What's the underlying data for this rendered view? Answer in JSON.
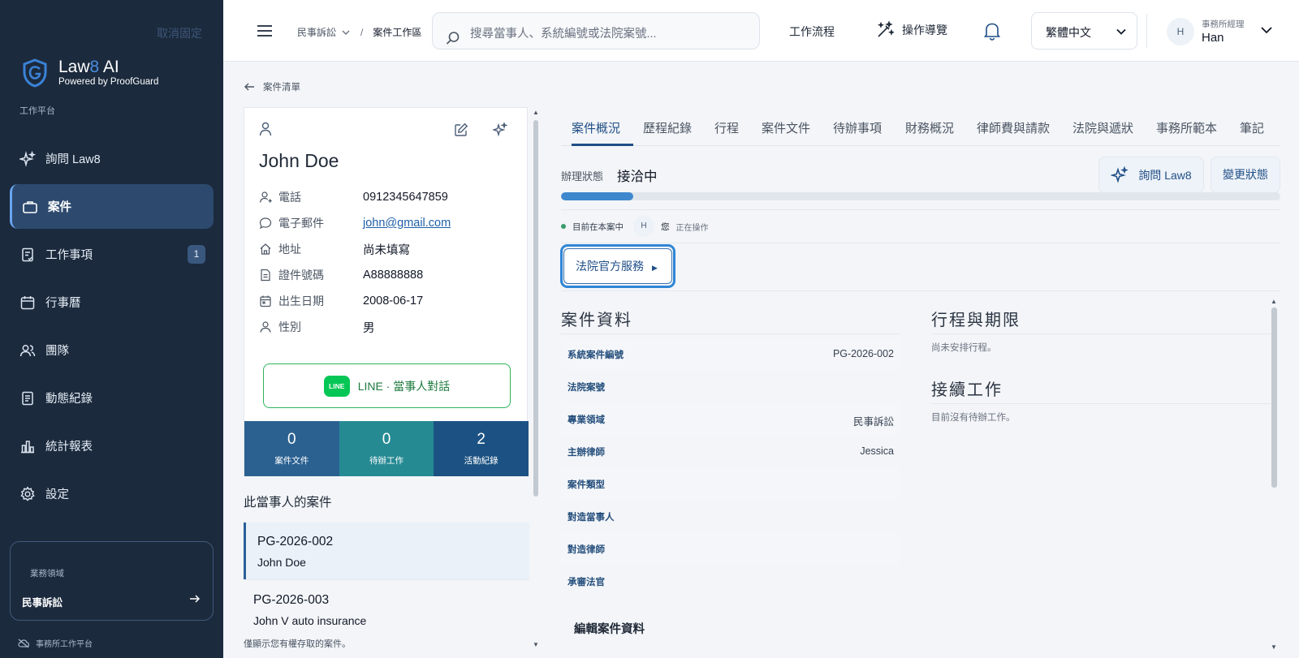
{
  "sidebar": {
    "unpin_label": "取消固定",
    "brand_prefix": "Law",
    "brand_eight": "8",
    "brand_suffix": " AI",
    "brand_sub": "Powered by ProofGuard",
    "section_label": "工作平台",
    "items": [
      {
        "label": "詢問 Law8",
        "icon": "sparkle-icon"
      },
      {
        "label": "案件",
        "icon": "briefcase-icon",
        "active": true
      },
      {
        "label": "工作事項",
        "icon": "task-icon",
        "badge": "1"
      },
      {
        "label": "行事曆",
        "icon": "calendar-icon"
      },
      {
        "label": "團隊",
        "icon": "team-icon"
      },
      {
        "label": "動態紀錄",
        "icon": "log-icon"
      },
      {
        "label": "統計報表",
        "icon": "chart-icon"
      },
      {
        "label": "設定",
        "icon": "gear-icon"
      }
    ],
    "domain_label": "業務領域",
    "domain_value": "民事訴訟",
    "footer_status": "事務所工作平台"
  },
  "topbar": {
    "breadcrumb_parent": "民事訴訟",
    "breadcrumb_current": "案件工作區",
    "search_placeholder": "搜尋當事人、系統編號或法院案號...",
    "workflow_label": "工作流程",
    "guide_label": "操作導覽",
    "language": "繁體中文",
    "user_role": "事務所經理",
    "user_name": "Han",
    "user_initial": "H"
  },
  "back_label": "案件清單",
  "client": {
    "name": "John Doe",
    "fields": [
      {
        "label": "電話",
        "value": "0912345647859"
      },
      {
        "label": "電子郵件",
        "value": "john@gmail.com"
      },
      {
        "label": "地址",
        "value": "尚未填寫"
      },
      {
        "label": "證件號碼",
        "value": "A88888888"
      },
      {
        "label": "出生日期",
        "value": "2008-06-17"
      },
      {
        "label": "性別",
        "value": "男"
      }
    ],
    "line_logo": "LINE",
    "line_button": "LINE · 當事人對話",
    "stats": [
      {
        "num": "0",
        "label": "案件文件",
        "color": "#2b6191"
      },
      {
        "num": "0",
        "label": "待辦工作",
        "color": "#268a93"
      },
      {
        "num": "2",
        "label": "活動紀錄",
        "color": "#1c5283"
      }
    ]
  },
  "client_cases": {
    "heading": "此當事人的案件",
    "items": [
      {
        "id": "PG-2026-002",
        "name": "John Doe"
      },
      {
        "id": "PG-2026-003",
        "name": "John V auto insurance"
      }
    ],
    "note": "僅顯示您有權存取的案件。"
  },
  "tabs": [
    "案件概況",
    "歷程紀錄",
    "行程",
    "案件文件",
    "待辦事項",
    "財務概況",
    "律師費與請款",
    "法院與遞狀",
    "事務所範本",
    "筆記"
  ],
  "status": {
    "label": "辦理狀態",
    "value": "接洽中",
    "progress": 0.1,
    "ask_button": "詢問 Law8",
    "change_button": "變更狀態"
  },
  "presence": {
    "text": "目前在本案中",
    "initial": "H",
    "you": "您",
    "operating": "正在操作"
  },
  "court_button": "法院官方服務",
  "court_button_arrow": "▶",
  "case_info": {
    "heading": "案件資料",
    "rows": [
      {
        "label": "系統案件編號",
        "value": "PG-2026-002"
      },
      {
        "label": "法院案號",
        "value": ""
      },
      {
        "label": "專業領域",
        "value": "民事訴訟"
      },
      {
        "label": "主辦律師",
        "value": "Jessica"
      },
      {
        "label": "案件類型",
        "value": ""
      },
      {
        "label": "對造當事人",
        "value": ""
      },
      {
        "label": "對造律師",
        "value": ""
      },
      {
        "label": "承審法官",
        "value": ""
      }
    ],
    "edit_heading": "編輯案件資料"
  },
  "schedule": {
    "heading": "行程與期限",
    "empty": "尚未安排行程。"
  },
  "followup": {
    "heading": "接續工作",
    "empty": "目前沒有待辦工作。"
  }
}
